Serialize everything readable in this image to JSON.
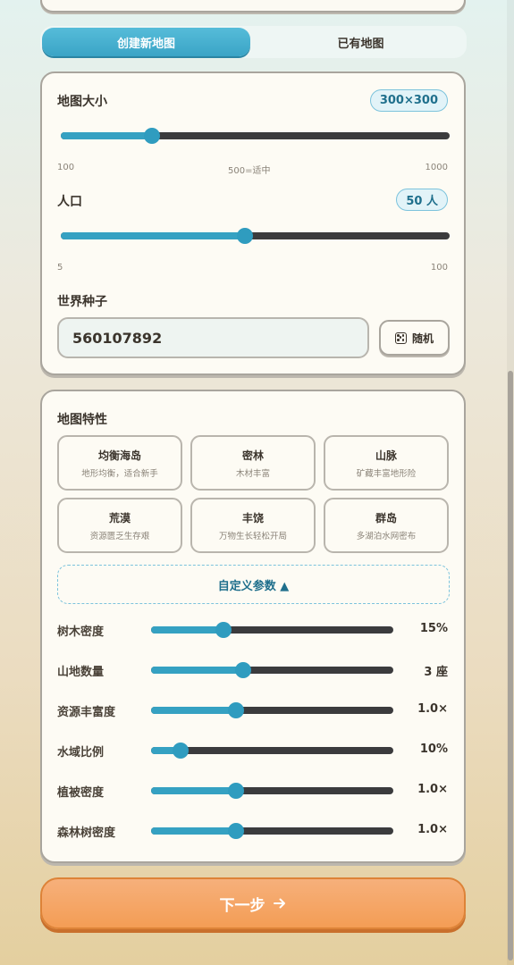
{
  "tabs": {
    "create": "创建新地图",
    "existing": "已有地图"
  },
  "map_size": {
    "label": "地图大小",
    "value_display": "300×300",
    "min_label": "100",
    "mid_label": "500=适中",
    "max_label": "1000",
    "fraction": 0.234
  },
  "population": {
    "label": "人口",
    "value_display": "50 人",
    "min_label": "5",
    "max_label": "100",
    "fraction": 0.474
  },
  "seed": {
    "label": "世界种子",
    "value": "560107892",
    "random_label": "随机",
    "icon": "dice-icon"
  },
  "features": {
    "title": "地图特性",
    "items": [
      {
        "title": "均衡海岛",
        "desc": "地形均衡，适合新手"
      },
      {
        "title": "密林",
        "desc": "木材丰富"
      },
      {
        "title": "山脉",
        "desc": "矿藏丰富地形险"
      },
      {
        "title": "荒漠",
        "desc": "资源匮乏生存艰"
      },
      {
        "title": "丰饶",
        "desc": "万物生长轻松开局"
      },
      {
        "title": "群岛",
        "desc": "多湖泊水网密布"
      }
    ]
  },
  "custom": {
    "toggle_label": "自定义参数 ▲",
    "params": [
      {
        "label": "树木密度",
        "value": "15%",
        "fraction": 0.3
      },
      {
        "label": "山地数量",
        "value": "3 座",
        "fraction": 0.38
      },
      {
        "label": "资源丰富度",
        "value": "1.0×",
        "fraction": 0.35
      },
      {
        "label": "水域比例",
        "value": "10%",
        "fraction": 0.12
      },
      {
        "label": "植被密度",
        "value": "1.0×",
        "fraction": 0.35
      },
      {
        "label": "森林树密度",
        "value": "1.0×",
        "fraction": 0.35
      }
    ]
  },
  "next_button": {
    "label": "下一步",
    "icon": "arrow-right-icon"
  },
  "colors": {
    "accent": "#35a1c2",
    "slider_track": "#3b3b3d",
    "primary_button": "#f49d55"
  }
}
